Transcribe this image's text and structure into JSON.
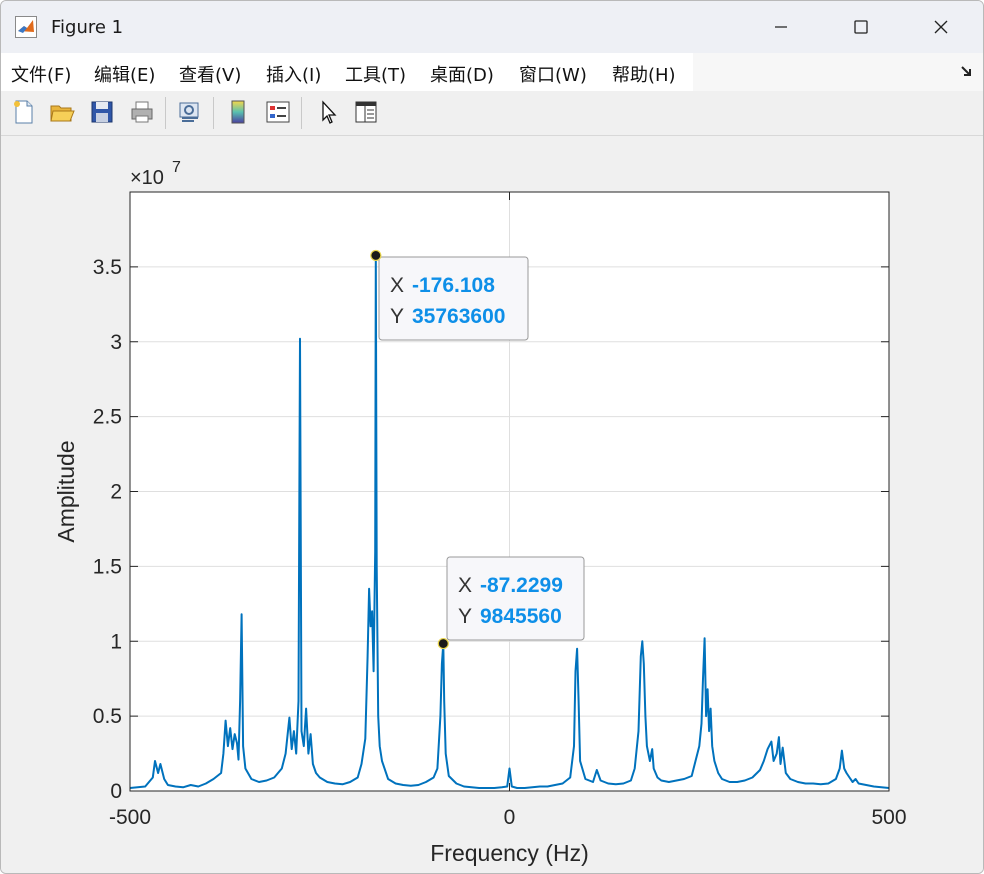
{
  "window": {
    "title": "Figure 1"
  },
  "menu": [
    "文件(F)",
    "编辑(E)",
    "查看(V)",
    "插入(I)",
    "工具(T)",
    "桌面(D)",
    "窗口(W)",
    "帮助(H)"
  ],
  "toolbar_icons": [
    "new-figure-icon",
    "open-file-icon",
    "save-icon",
    "print-icon",
    "link-plot-icon",
    "insert-colorbar-icon",
    "insert-legend-icon",
    "edit-plot-arrow-icon",
    "property-inspector-icon"
  ],
  "chart_data": {
    "type": "line",
    "xlabel": "Frequency (Hz)",
    "ylabel": "Amplitude",
    "exponent_label": "×10",
    "exponent_power": "7",
    "xlim": [
      -500,
      500
    ],
    "ylim": [
      0,
      40000000.0
    ],
    "x_ticks": [
      -500,
      0,
      500
    ],
    "x_tick_labels": [
      "-500",
      "0",
      "500"
    ],
    "y_ticks": [
      0,
      5000000.0,
      10000000.0,
      15000000.0,
      20000000.0,
      25000000.0,
      30000000.0,
      35000000.0
    ],
    "y_tick_labels": [
      "0",
      "0.5",
      "1",
      "1.5",
      "2",
      "2.5",
      "3",
      "3.5"
    ],
    "grid": true,
    "line_color": "#0072bd",
    "series": [
      {
        "values": [
          [
            -500,
            200000
          ],
          [
            -490,
            250000
          ],
          [
            -480,
            300000
          ],
          [
            -470,
            900000
          ],
          [
            -467,
            2000000
          ],
          [
            -463,
            1200000
          ],
          [
            -460,
            1800000
          ],
          [
            -455,
            800000
          ],
          [
            -450,
            400000
          ],
          [
            -440,
            300000
          ],
          [
            -430,
            250000
          ],
          [
            -420,
            400000
          ],
          [
            -410,
            300000
          ],
          [
            -400,
            500000
          ],
          [
            -390,
            800000
          ],
          [
            -380,
            1200000
          ],
          [
            -377,
            2500000
          ],
          [
            -374,
            4700000
          ],
          [
            -371,
            3000000
          ],
          [
            -368,
            4200000
          ],
          [
            -365,
            2800000
          ],
          [
            -362,
            3800000
          ],
          [
            -359,
            3200000
          ],
          [
            -357,
            2100000
          ],
          [
            -355,
            6000000
          ],
          [
            -353,
            11800000
          ],
          [
            -351,
            3000000
          ],
          [
            -348,
            1500000
          ],
          [
            -340,
            800000
          ],
          [
            -330,
            600000
          ],
          [
            -320,
            700000
          ],
          [
            -310,
            900000
          ],
          [
            -300,
            1500000
          ],
          [
            -295,
            2500000
          ],
          [
            -290,
            4900000
          ],
          [
            -287,
            2800000
          ],
          [
            -284,
            4000000
          ],
          [
            -281,
            2500000
          ],
          [
            -278,
            6000000
          ],
          [
            -276,
            30200000
          ],
          [
            -274,
            4000000
          ],
          [
            -271,
            3000000
          ],
          [
            -268,
            5500000
          ],
          [
            -265,
            2500000
          ],
          [
            -262,
            3800000
          ],
          [
            -259,
            1800000
          ],
          [
            -255,
            1200000
          ],
          [
            -250,
            900000
          ],
          [
            -240,
            600000
          ],
          [
            -230,
            500000
          ],
          [
            -220,
            450000
          ],
          [
            -210,
            600000
          ],
          [
            -200,
            900000
          ],
          [
            -195,
            1800000
          ],
          [
            -190,
            3500000
          ],
          [
            -187,
            9000000
          ],
          [
            -185,
            13500000
          ],
          [
            -183,
            11000000
          ],
          [
            -181,
            12000000
          ],
          [
            -179,
            8000000
          ],
          [
            -177,
            16000000
          ],
          [
            -176.108,
            35763600
          ],
          [
            -175,
            15000000
          ],
          [
            -173,
            5000000
          ],
          [
            -171,
            3000000
          ],
          [
            -168,
            2000000
          ],
          [
            -160,
            800000
          ],
          [
            -150,
            500000
          ],
          [
            -140,
            400000
          ],
          [
            -130,
            350000
          ],
          [
            -120,
            400000
          ],
          [
            -110,
            600000
          ],
          [
            -100,
            900000
          ],
          [
            -95,
            1500000
          ],
          [
            -91,
            5000000
          ],
          [
            -89,
            8500000
          ],
          [
            -87.2299,
            9845560
          ],
          [
            -86,
            6000000
          ],
          [
            -84,
            2500000
          ],
          [
            -80,
            1000000
          ],
          [
            -70,
            500000
          ],
          [
            -60,
            300000
          ],
          [
            -50,
            250000
          ],
          [
            -40,
            200000
          ],
          [
            -30,
            200000
          ],
          [
            -20,
            200000
          ],
          [
            -10,
            250000
          ],
          [
            -3,
            300000
          ],
          [
            0,
            1500000
          ],
          [
            3,
            300000
          ],
          [
            10,
            200000
          ],
          [
            20,
            200000
          ],
          [
            30,
            250000
          ],
          [
            40,
            300000
          ],
          [
            50,
            300000
          ],
          [
            60,
            400000
          ],
          [
            70,
            500000
          ],
          [
            80,
            900000
          ],
          [
            85,
            3000000
          ],
          [
            87,
            8000000
          ],
          [
            89,
            9500000
          ],
          [
            91,
            6000000
          ],
          [
            93,
            2000000
          ],
          [
            100,
            800000
          ],
          [
            110,
            600000
          ],
          [
            115,
            1400000
          ],
          [
            120,
            700000
          ],
          [
            130,
            500000
          ],
          [
            140,
            450000
          ],
          [
            150,
            500000
          ],
          [
            160,
            700000
          ],
          [
            165,
            1500000
          ],
          [
            170,
            4000000
          ],
          [
            173,
            9000000
          ],
          [
            175,
            10000000
          ],
          [
            177,
            8500000
          ],
          [
            179,
            5000000
          ],
          [
            181,
            3000000
          ],
          [
            185,
            2000000
          ],
          [
            188,
            2800000
          ],
          [
            190,
            1500000
          ],
          [
            195,
            900000
          ],
          [
            200,
            700000
          ],
          [
            210,
            600000
          ],
          [
            220,
            700000
          ],
          [
            230,
            800000
          ],
          [
            240,
            1000000
          ],
          [
            245,
            2000000
          ],
          [
            250,
            3000000
          ],
          [
            253,
            4500000
          ],
          [
            255,
            7500000
          ],
          [
            257,
            10200000
          ],
          [
            259,
            5000000
          ],
          [
            261,
            6800000
          ],
          [
            263,
            4000000
          ],
          [
            265,
            5500000
          ],
          [
            267,
            3000000
          ],
          [
            270,
            2000000
          ],
          [
            275,
            1200000
          ],
          [
            280,
            800000
          ],
          [
            290,
            600000
          ],
          [
            300,
            600000
          ],
          [
            310,
            700000
          ],
          [
            320,
            900000
          ],
          [
            330,
            1400000
          ],
          [
            335,
            2000000
          ],
          [
            340,
            2800000
          ],
          [
            345,
            3300000
          ],
          [
            348,
            2000000
          ],
          [
            352,
            2500000
          ],
          [
            355,
            3600000
          ],
          [
            357,
            1800000
          ],
          [
            360,
            2900000
          ],
          [
            364,
            1200000
          ],
          [
            370,
            800000
          ],
          [
            380,
            600000
          ],
          [
            390,
            500000
          ],
          [
            400,
            500000
          ],
          [
            410,
            450000
          ],
          [
            420,
            500000
          ],
          [
            430,
            800000
          ],
          [
            435,
            1500000
          ],
          [
            438,
            2700000
          ],
          [
            441,
            1500000
          ],
          [
            444,
            1200000
          ],
          [
            448,
            900000
          ],
          [
            452,
            600000
          ],
          [
            456,
            800000
          ],
          [
            460,
            500000
          ],
          [
            470,
            400000
          ],
          [
            480,
            300000
          ],
          [
            490,
            250000
          ],
          [
            500,
            200000
          ]
        ]
      }
    ],
    "datatips": [
      {
        "x": -176.108,
        "y": 35763600,
        "x_label": "X",
        "x_text": "-176.108",
        "y_label": "Y",
        "y_text": "35763600"
      },
      {
        "x": -87.2299,
        "y": 9845560,
        "x_label": "X",
        "x_text": "-87.2299",
        "y_label": "Y",
        "y_text": "9845560"
      }
    ]
  }
}
